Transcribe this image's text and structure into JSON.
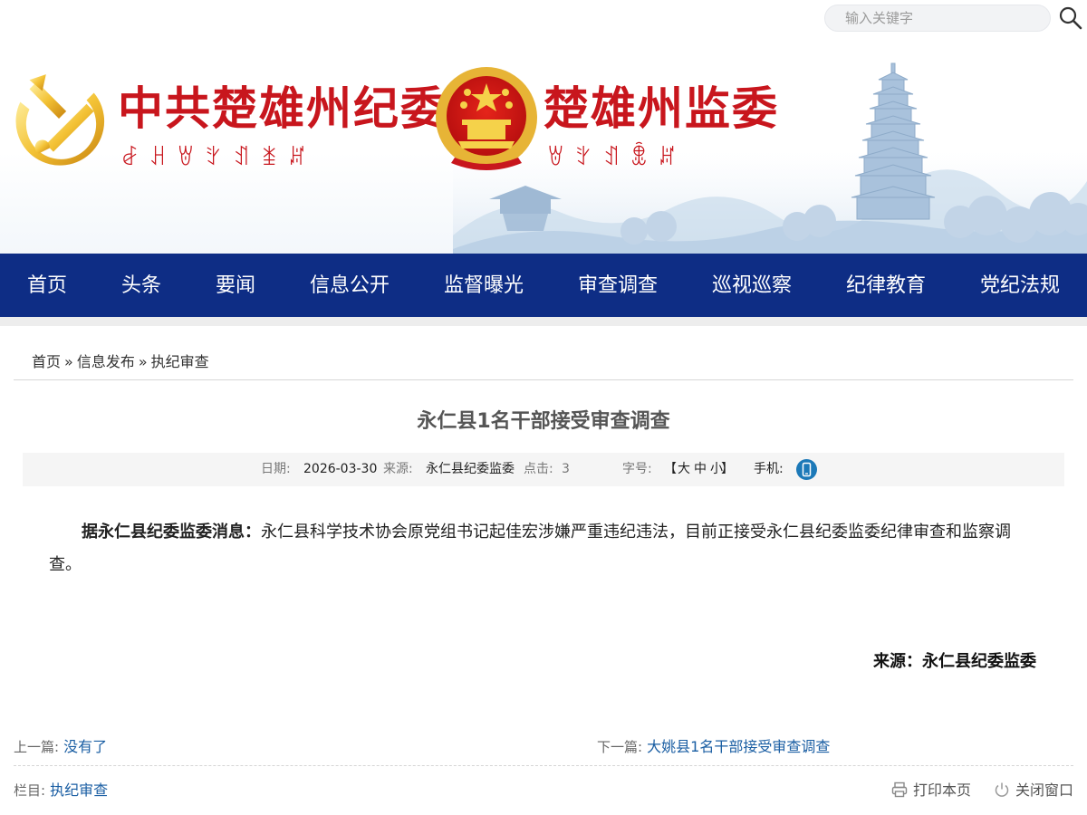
{
  "search": {
    "placeholder": "输入关键字",
    "icon": "search-icon"
  },
  "header": {
    "title_party": "中共楚雄州纪委",
    "title_party_yi": "ꆀꃅꇐꇬꀊꁧꏦ",
    "title_state": "楚雄州监委",
    "title_state_yi": "ꇐꇬꀊꂬꏦ",
    "colors": {
      "brand_red": "#c8161d",
      "nav_blue": "#0e2d85"
    }
  },
  "nav": {
    "items": [
      {
        "label": "首页"
      },
      {
        "label": "头条"
      },
      {
        "label": "要闻"
      },
      {
        "label": "信息公开"
      },
      {
        "label": "监督曝光"
      },
      {
        "label": "审查调查"
      },
      {
        "label": "巡视巡察"
      },
      {
        "label": "纪律教育"
      },
      {
        "label": "党纪法规"
      }
    ]
  },
  "breadcrumb": {
    "items": [
      "首页",
      "信息发布",
      "执纪审查"
    ],
    "separator": "»"
  },
  "article": {
    "title": "永仁县1名干部接受审查调查",
    "meta": {
      "date_label": "日期:",
      "date": "2026-03-30",
      "source_label": "来源:",
      "source": "永仁县纪委监委",
      "clicks_label": "点击:",
      "clicks": "3",
      "fontsize_label": "字号:",
      "fontsize_open": "【",
      "fontsize_large": "大",
      "fontsize_medium": "中",
      "fontsize_small": "小",
      "fontsize_close": "】",
      "mobile_label": "手机:"
    },
    "lead": "据永仁县纪委监委消息：",
    "body": "永仁县科学技术协会原党组书记起佳宏涉嫌严重违纪违法，目前正接受永仁县纪委监委纪律审查和监察调查。",
    "source_footer": "来源：永仁县纪委监委"
  },
  "pager": {
    "prev_label": "上一篇:",
    "prev": "没有了",
    "next_label": "下一篇:",
    "next": "大姚县1名干部接受审查调查"
  },
  "footer": {
    "column_label": "栏目:",
    "column": "执纪审查",
    "print": "打印本页",
    "close": "关闭窗口"
  }
}
